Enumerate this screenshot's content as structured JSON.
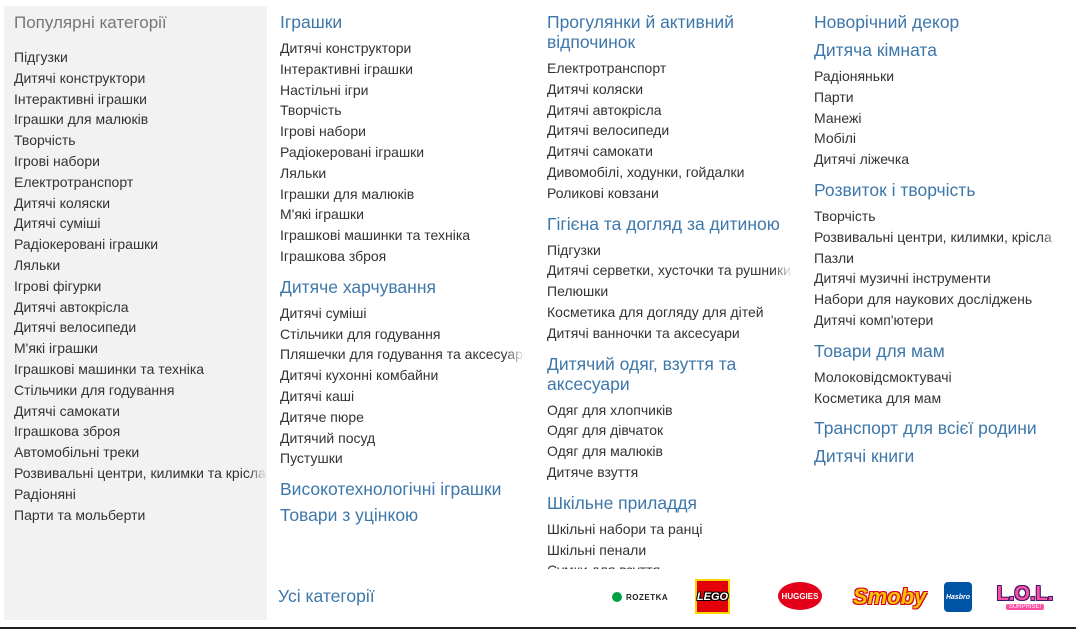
{
  "sidebar": {
    "title": "Популярні категорії",
    "items": [
      "Підгузки",
      "Дитячі конструктори",
      "Інтерактивні іграшки",
      "Іграшки для малюків",
      "Творчість",
      "Ігрові набори",
      "Електротранспорт",
      "Дитячі коляски",
      "Дитячі суміші",
      "Радіокеровані іграшки",
      "Ляльки",
      "Ігрові фігурки",
      "Дитячі автокрісла",
      "Дитячі велосипеди",
      "М'які іграшки",
      "Іграшкові машинки та техніка",
      "Стільчики для годування",
      "Дитячі самокати",
      "Іграшкова зброя",
      "Автомобільні треки",
      "Розвивальні центри, килимки та крісла",
      "Радіоняні",
      "Парти та мольберти"
    ]
  },
  "col1": {
    "g1": {
      "title": "Іграшки",
      "items": [
        "Дитячі конструктори",
        "Інтерактивні іграшки",
        "Настільні ігри",
        "Творчість",
        "Ігрові набори",
        "Радіокеровані іграшки",
        "Ляльки",
        "Іграшки для малюків",
        "М'які іграшки",
        "Іграшкові машинки та техніка",
        "Іграшкова зброя"
      ]
    },
    "g2": {
      "title": "Дитяче харчування",
      "items": [
        "Дитячі суміші",
        "Стільчики для годування",
        "Пляшечки для годування та аксесуари",
        "Дитячі кухонні комбайни",
        "Дитячі каші",
        "Дитяче пюре",
        "Дитячий посуд",
        "Пустушки"
      ]
    },
    "g3": {
      "title": "Високотехнологічні іграшки"
    },
    "g4": {
      "title": "Товари з уцінкою"
    }
  },
  "col2": {
    "g1": {
      "title": "Прогулянки й активний відпочинок",
      "items": [
        "Електротранспорт",
        "Дитячі коляски",
        "Дитячі автокрісла",
        "Дитячі велосипеди",
        "Дитячі самокати",
        "Дивомобілі, ходунки, гойдалки",
        "Роликові ковзани"
      ]
    },
    "g2": {
      "title": "Гігієна та догляд за дитиною",
      "items": [
        "Підгузки",
        "Дитячі серветки, хусточки та рушники",
        "Пелюшки",
        "Косметика для догляду для дітей",
        "Дитячі ванночки та аксесуари"
      ]
    },
    "g3": {
      "title": "Дитячий одяг, взуття та аксесуари",
      "items": [
        "Одяг для хлопчиків",
        "Одяг для дівчаток",
        "Одяг для малюків",
        "Дитяче взуття"
      ]
    },
    "g4": {
      "title": "Шкільне приладдя",
      "items": [
        "Шкільні набори та ранці",
        "Шкільні пенали",
        "Сумки для взуття"
      ]
    }
  },
  "col3": {
    "g1": {
      "title": "Новорічний декор"
    },
    "g2": {
      "title": "Дитяча кімната",
      "items": [
        "Радіоняньки",
        "Парти",
        "Манежі",
        "Мобілі",
        "Дитячі ліжечка"
      ]
    },
    "g3": {
      "title": "Розвиток і творчість",
      "items": [
        "Творчість",
        "Розвивальні центри, килимки, крісла",
        "Пазли",
        "Дитячі музичні інструменти",
        "Набори для наукових досліджень",
        "Дитячі комп'ютери"
      ]
    },
    "g4": {
      "title": "Товари для мам",
      "items": [
        "Молоковідсмоктувачі",
        "Косметика для мам"
      ]
    },
    "g5": {
      "title": "Транспорт для всієї родини"
    },
    "g6": {
      "title": "Дитячі книги"
    }
  },
  "footer": {
    "all_categories": "Усі категорії",
    "brands": {
      "rozetka": "ROZETKA",
      "lego": "LEGO",
      "huggies": "HUGGIES",
      "smoby": "Smoby",
      "hasbro": "Hasbro",
      "lol": "L.O.L.",
      "lol_sub": "SURPRISE!"
    }
  },
  "colors": {
    "link_blue": "#3e77aa",
    "text": "#333333",
    "sidebar_bg": "#f2f2f2"
  }
}
